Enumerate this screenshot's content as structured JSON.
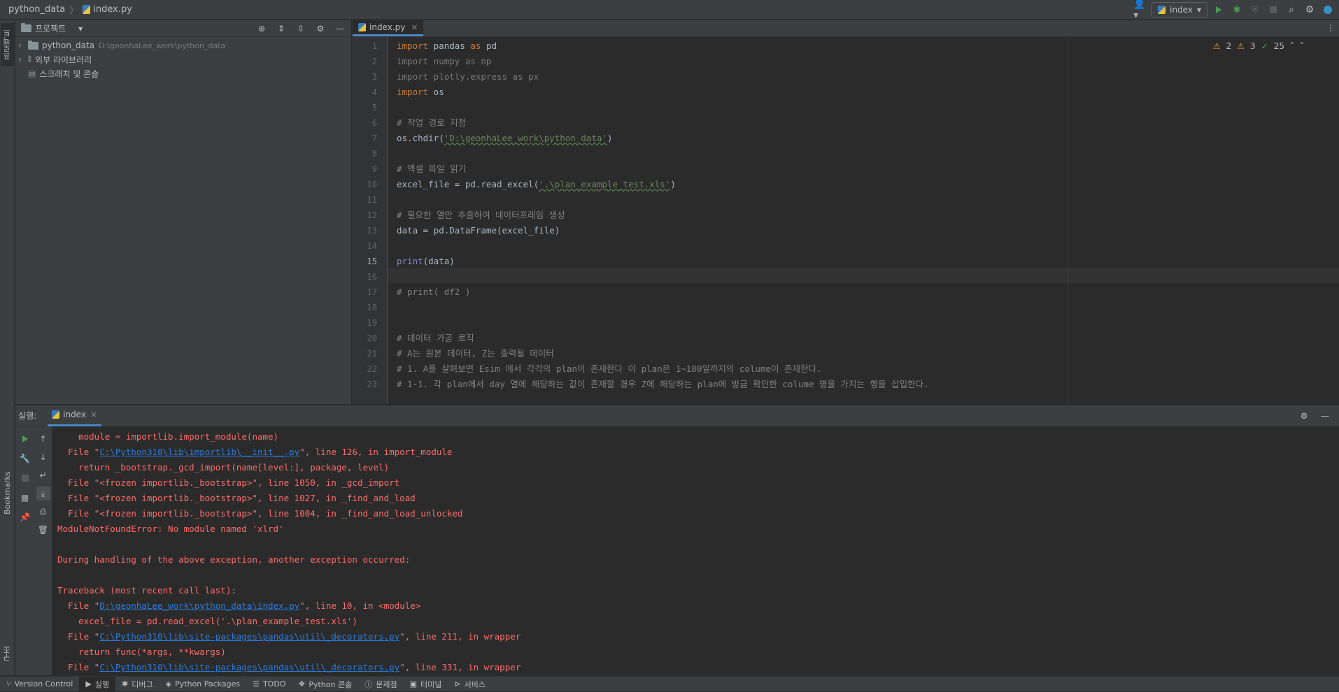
{
  "titlebar": {
    "project": "python_data",
    "file": "index.py",
    "run_config": "index"
  },
  "left_strip": {
    "project_tab": "프로젝트",
    "bookmarks_tab": "Bookmarks",
    "structure_tab": "구조"
  },
  "project_panel": {
    "header": "프로젝트",
    "tree": [
      {
        "label": "python_data",
        "path": "D:\\geonhaLee_work\\python_data"
      },
      {
        "label": "외부 라이브러리"
      },
      {
        "label": "스크래치 및 콘솔"
      }
    ]
  },
  "editor": {
    "tab": "index.py",
    "inspection": {
      "warnings": "2",
      "weak_warnings": "3",
      "typos": "25"
    },
    "line_numbers": [
      "1",
      "2",
      "3",
      "4",
      "5",
      "6",
      "7",
      "8",
      "9",
      "10",
      "11",
      "12",
      "13",
      "14",
      "15",
      "16",
      "17",
      "18",
      "19",
      "20",
      "21",
      "22",
      "23"
    ],
    "lines": {
      "l1_kw": "import",
      "l1_a": " pandas ",
      "l1_as": "as",
      "l1_b": " pd",
      "l2": "import numpy as np",
      "l3": "import plotly.express as px",
      "l4_kw": "import",
      "l4_b": " os",
      "l6": "# 작업 경로 지정",
      "l7_a": "os.chdir(",
      "l7_s": "'D:\\geonhaLee_work\\python_data'",
      "l7_b": ")",
      "l9": "# 엑셀 파일 읽기",
      "l10_a": "excel_file = pd.read_excel(",
      "l10_s": "'.\\plan_example_test.xls'",
      "l10_b": ")",
      "l12": "# 필요한 열만 추출하여 데이터프레임 생성",
      "l13": "data = pd.DataFrame(excel_file)",
      "l15_fn": "print",
      "l15_b": "(data)",
      "l17": "# print( df2 )",
      "l20": "# 데이터 가공 로직",
      "l21": "# A는 원본 데이터, Z는 출력될 데이터",
      "l22": "# 1. A를 살펴보면 Esim 에서 각각의 plan이 존재한다 이 plan은 1~180일까지의 colume이 존재한다.",
      "l23": "# 1-1. 각 plan에서 day 열에 해당하는 값이 존재할 경우 Z에 해당하는 plan에 방금 확인한 colume 명을 가지는 행을 삽입한다."
    }
  },
  "run_panel": {
    "label": "실행:",
    "tab": "index",
    "console": [
      {
        "t": "    module = importlib.import_module(name)"
      },
      {
        "pre": "  File \"",
        "link": "C:\\Python310\\lib\\importlib\\__init__.py",
        "post": "\", line 126, in import_module"
      },
      {
        "t": "    return _bootstrap._gcd_import(name[level:], package, level)"
      },
      {
        "t": "  File \"<frozen importlib._bootstrap>\", line 1050, in _gcd_import"
      },
      {
        "t": "  File \"<frozen importlib._bootstrap>\", line 1027, in _find_and_load"
      },
      {
        "t": "  File \"<frozen importlib._bootstrap>\", line 1004, in _find_and_load_unlocked"
      },
      {
        "t": "ModuleNotFoundError: No module named 'xlrd'"
      },
      {
        "t": ""
      },
      {
        "t": "During handling of the above exception, another exception occurred:"
      },
      {
        "t": ""
      },
      {
        "t": "Traceback (most recent call last):"
      },
      {
        "pre": "  File \"",
        "link": "D:\\geonhaLee_work\\python_data\\index.py",
        "post": "\", line 10, in <module>"
      },
      {
        "t": "    excel_file = pd.read_excel('.\\plan_example_test.xls')"
      },
      {
        "pre": "  File \"",
        "link": "C:\\Python310\\lib\\site-packages\\pandas\\util\\_decorators.py",
        "post": "\", line 211, in wrapper"
      },
      {
        "t": "    return func(*args, **kwargs)"
      },
      {
        "pre": "  File \"",
        "link": "C:\\Python310\\lib\\site-packages\\pandas\\util\\_decorators.py",
        "post": "\", line 331, in wrapper"
      }
    ]
  },
  "statusbar": {
    "items": [
      "Version Control",
      "실행",
      "디버그",
      "Python Packages",
      "TODO",
      "Python 콘솔",
      "문제점",
      "터미널",
      "서비스"
    ]
  },
  "colors": {
    "error": "#ff6b68",
    "link": "#287bde",
    "run_green": "#499c54",
    "accent": "#4a88c7"
  }
}
